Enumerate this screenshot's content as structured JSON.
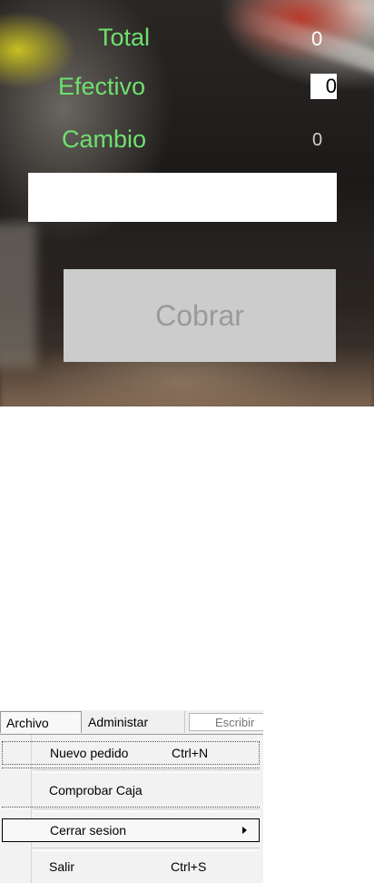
{
  "payment": {
    "total_label": "Total",
    "total_value": "0",
    "cash_label": "Efectivo",
    "cash_value": "0",
    "change_label": "Cambio",
    "change_value": "0",
    "input_value": "",
    "charge_button": "Cobrar"
  },
  "menu": {
    "tabs": [
      "Archivo",
      "Administar"
    ],
    "search_placeholder": "Escribir",
    "items": [
      {
        "label": "Nuevo pedido",
        "shortcut": "Ctrl+N"
      },
      {
        "label": "Comprobar Caja",
        "shortcut": ""
      },
      {
        "label": "Cerrar sesion",
        "shortcut": ""
      },
      {
        "label": "Salir",
        "shortcut": "Ctrl+S"
      }
    ]
  },
  "colors": {
    "label_green": "#6ee16e",
    "button_gray": "#cccccc"
  }
}
